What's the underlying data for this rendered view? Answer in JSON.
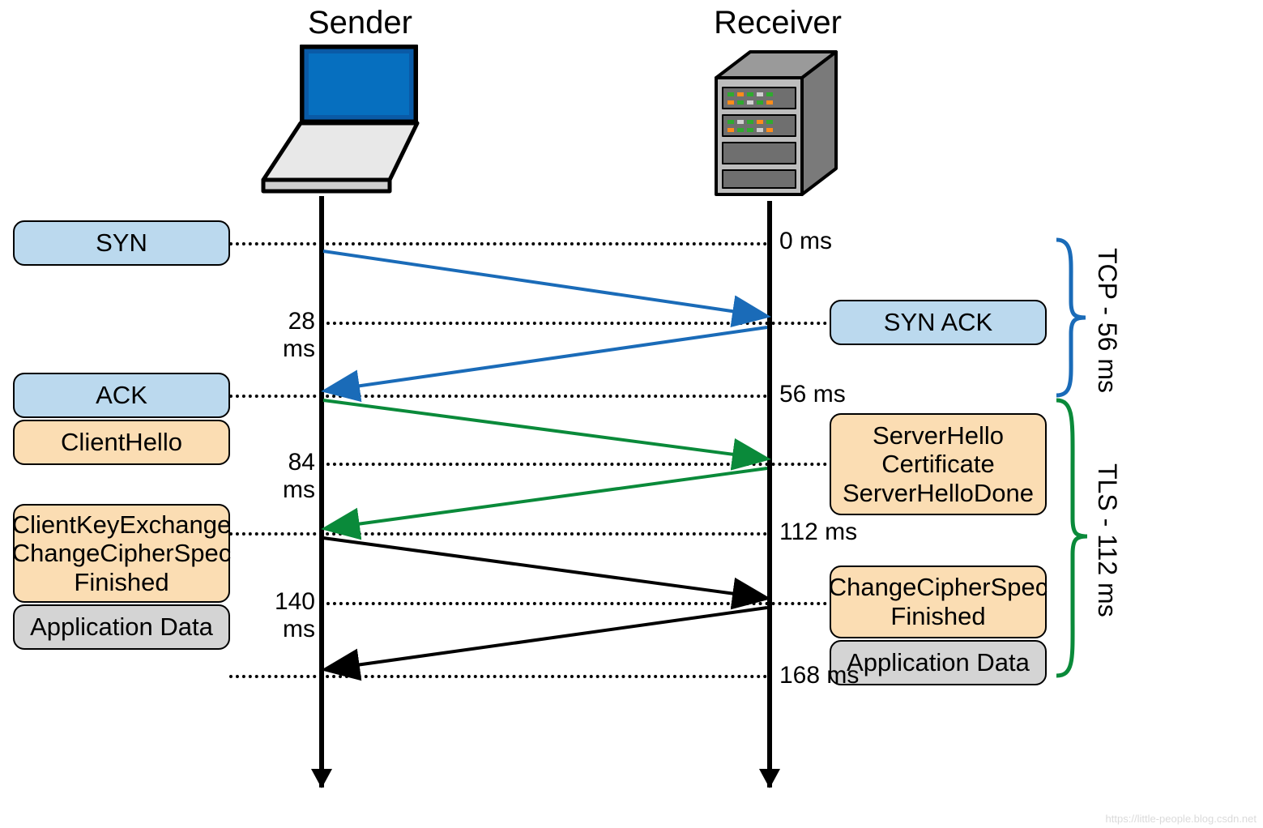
{
  "labels": {
    "sender": "Sender",
    "receiver": "Receiver"
  },
  "times": {
    "t0": "0 ms",
    "t28": "28 ms",
    "t56": "56 ms",
    "t84": "84 ms",
    "t112": "112 ms",
    "t140": "140 ms",
    "t168": "168 ms"
  },
  "left_boxes": {
    "syn": "SYN",
    "ack": "ACK",
    "clienthello": "ClientHello",
    "cke_l1": "ClientKeyExchange",
    "cke_l2": "ChangeCipherSpec",
    "cke_l3": "Finished",
    "appdata": "Application Data"
  },
  "right_boxes": {
    "synack": "SYN ACK",
    "sh_l1": "ServerHello",
    "sh_l2": "Certificate",
    "sh_l3": "ServerHelloDone",
    "ccs_l1": "ChangeCipherSpec",
    "ccs_l2": "Finished",
    "appdata": "Application Data"
  },
  "brackets": {
    "tcp": "TCP - 56 ms",
    "tls": "TLS - 112 ms"
  },
  "watermark": "https://little-people.blog.csdn.net",
  "colors": {
    "tcp_arrow": "#1a6bb8",
    "tls_arrow": "#0a8a3a",
    "app_arrow": "#000000",
    "tcp_bracket": "#1a6bb8",
    "tls_bracket": "#0a8a3a"
  },
  "chart_data": {
    "type": "sequence",
    "actors": [
      "Sender",
      "Receiver"
    ],
    "events": [
      {
        "t_ms": 0,
        "at": "Sender",
        "msg": "SYN",
        "phase": "TCP",
        "dir": "→"
      },
      {
        "t_ms": 28,
        "at": "Receiver",
        "msg": "SYN ACK",
        "phase": "TCP",
        "dir": "←"
      },
      {
        "t_ms": 56,
        "at": "Sender",
        "msg": "ACK",
        "phase": "TCP",
        "dir": "→"
      },
      {
        "t_ms": 56,
        "at": "Sender",
        "msg": "ClientHello",
        "phase": "TLS",
        "dir": "→"
      },
      {
        "t_ms": 84,
        "at": "Receiver",
        "msg": "ServerHello, Certificate, ServerHelloDone",
        "phase": "TLS",
        "dir": "←"
      },
      {
        "t_ms": 112,
        "at": "Sender",
        "msg": "ClientKeyExchange, ChangeCipherSpec, Finished",
        "phase": "TLS",
        "dir": "→"
      },
      {
        "t_ms": 140,
        "at": "Receiver",
        "msg": "ChangeCipherSpec, Finished",
        "phase": "TLS",
        "dir": "←"
      },
      {
        "t_ms": 168,
        "at": "Sender",
        "msg": "Application Data",
        "phase": "App",
        "dir": "→"
      },
      {
        "t_ms": 168,
        "at": "Receiver",
        "msg": "Application Data",
        "phase": "App",
        "dir": "←"
      }
    ],
    "phases": {
      "TCP": {
        "duration_ms": 56
      },
      "TLS": {
        "duration_ms": 112
      }
    }
  }
}
